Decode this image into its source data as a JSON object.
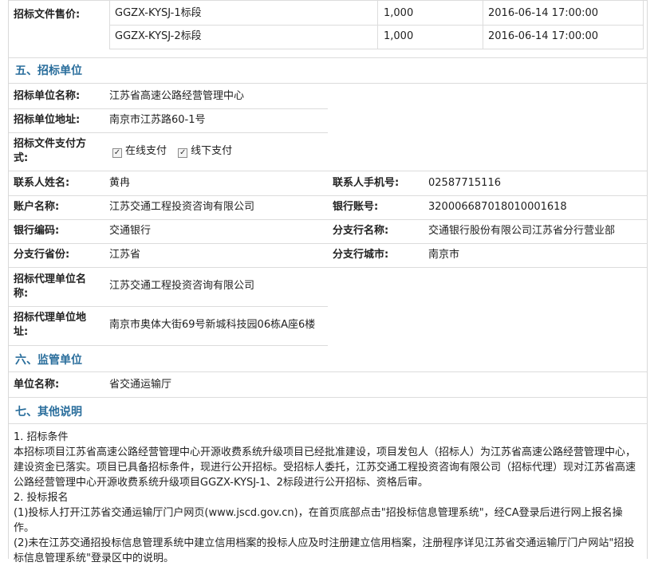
{
  "sale": {
    "label": "招标文件售价:",
    "rows": [
      {
        "section": "GGZX-KYSJ-1标段",
        "price": "1,000",
        "time": "2016-06-14 17:00:00"
      },
      {
        "section": "GGZX-KYSJ-2标段",
        "price": "1,000",
        "time": "2016-06-14 17:00:00"
      }
    ]
  },
  "tenderer": {
    "title": "五、招标单位",
    "name_label": "招标单位名称:",
    "name_value": "江苏省高速公路经营管理中心",
    "address_label": "招标单位地址:",
    "address_value": "南京市江苏路60-1号",
    "pay_label_1": "招标文件支付方",
    "pay_label_2": "式:",
    "pay_online": "在线支付",
    "pay_offline": "线下支付",
    "contact_label": "联系人姓名:",
    "contact_value": "黄冉",
    "phone_label": "联系人手机号:",
    "phone_value": "02587715116",
    "account_name_label": "账户名称:",
    "account_name_value": "江苏交通工程投资咨询有限公司",
    "bank_account_label": "银行账号:",
    "bank_account_value": "320006687018010001618",
    "bank_code_label": "银行编码:",
    "bank_code_value": "交通银行",
    "branch_name_label": "分支行名称:",
    "branch_name_value": "交通银行股份有限公司江苏省分行营业部",
    "branch_province_label": "分支行省份:",
    "branch_province_value": "江苏省",
    "branch_city_label": "分支行城市:",
    "branch_city_value": "南京市",
    "agent_name_label_1": "招标代理单位名",
    "agent_name_label_2": "称:",
    "agent_name_value": "江苏交通工程投资咨询有限公司",
    "agent_addr_label_1": "招标代理单位地",
    "agent_addr_label_2": "址:",
    "agent_addr_value": "南京市奥体大街69号新城科技园06栋A座6楼"
  },
  "supervisor": {
    "title": "六、监管单位",
    "name_label": "单位名称:",
    "name_value": "省交通运输厅"
  },
  "other": {
    "title": "七、其他说明",
    "lines": [
      "1. 招标条件",
      "本招标项目江苏省高速公路经营管理中心开源收费系统升级项目已经批准建设，项目发包人（招标人）为江苏省高速公路经营管理中心，",
      "建设资金已落实。项目已具备招标条件，现进行公开招标。受招标人委托，江苏交通工程投资咨询有限公司（招标代理）现对江苏省高速",
      "公路经营管理中心开源收费系统升级项目GGZX-KYSJ-1、2标段进行公开招标、资格后审。",
      "2. 投标报名",
      "(1)投标人打开江苏省交通运输厅门户网页(www.jscd.gov.cn)，在首页底部点击\"招投标信息管理系统\"，经CA登录后进行网上报名操",
      "作。",
      "(2)未在江苏交通招投标信息管理系统中建立信用档案的投标人应及时注册建立信用档案，注册程序详见江苏省交通运输厅门户网站\"招投",
      "标信息管理系统\"登录区中的说明。"
    ]
  }
}
